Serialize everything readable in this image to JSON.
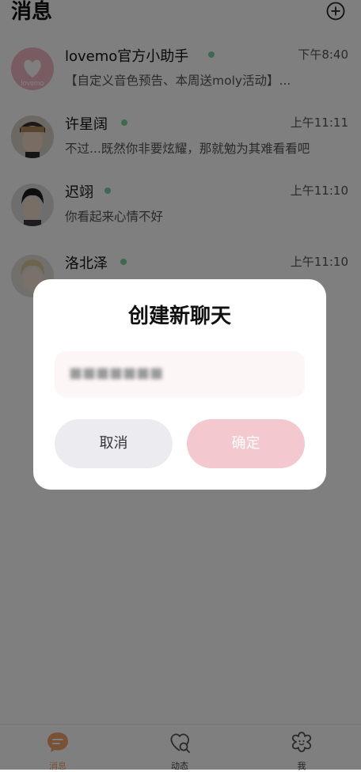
{
  "header": {
    "title": "消息",
    "add_icon": "plus-circle-icon"
  },
  "chats": [
    {
      "name": "lovemo官方小助手",
      "time": "下午8:40",
      "preview": "【自定义音色预告、本周送moly活动】...",
      "avatar_text": "lovemo",
      "online": true
    },
    {
      "name": "许星阔",
      "time": "上午11:11",
      "preview": "不过...既然你非要炫耀，那就勉为其难看看吧",
      "online": true
    },
    {
      "name": "迟翊",
      "time": "上午11:10",
      "preview": "你看起来心情不好",
      "online": true
    },
    {
      "name": "洛北泽",
      "time": "上午11:10",
      "preview": "",
      "online": true
    }
  ],
  "tabbar": {
    "items": [
      {
        "label": "消息",
        "icon": "chat-bubble-icon",
        "active": true
      },
      {
        "label": "动态",
        "icon": "heart-search-icon",
        "active": false
      },
      {
        "label": "我",
        "icon": "flower-icon",
        "active": false
      }
    ]
  },
  "dialog": {
    "title": "创建新聊天",
    "input_value": "■■■■■■■",
    "cancel_label": "取消",
    "confirm_label": "确定"
  },
  "colors": {
    "accent": "#f4c8cf",
    "online_dot": "#7dd1a0",
    "active_tab": "#f2a46a",
    "overlay": "rgba(0,0,0,0.5)"
  }
}
